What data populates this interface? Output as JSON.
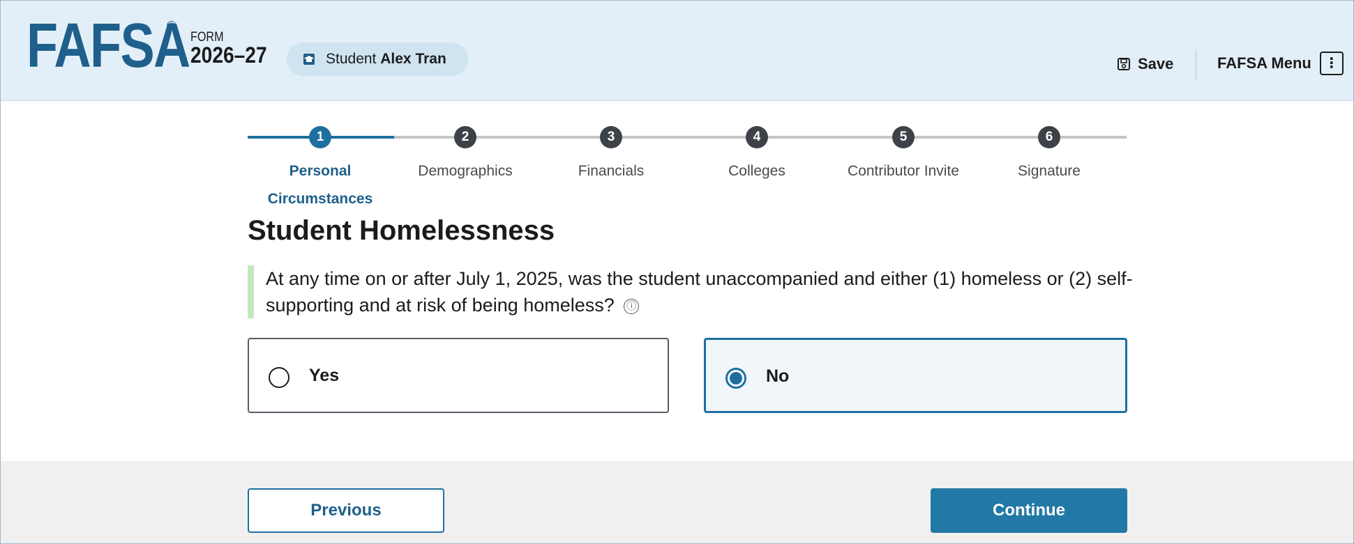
{
  "header": {
    "logo": "FAFSA",
    "logo_mark": "®",
    "form_label": "FORM",
    "form_year": "2026–27",
    "student_prefix": "Student",
    "student_name": "Alex Tran",
    "student_icon": "graduation-cap-icon",
    "save_label": "Save",
    "save_icon": "floppy-disk-icon",
    "menu_label": "FAFSA Menu",
    "menu_icon": "kebab-icon"
  },
  "stepper": {
    "steps": [
      {
        "number": "1",
        "label": "Personal Circumstances",
        "active": true
      },
      {
        "number": "2",
        "label": "Demographics",
        "active": false
      },
      {
        "number": "3",
        "label": "Financials",
        "active": false
      },
      {
        "number": "4",
        "label": "Colleges",
        "active": false
      },
      {
        "number": "5",
        "label": "Contributor Invite",
        "active": false
      },
      {
        "number": "6",
        "label": "Signature",
        "active": false
      }
    ]
  },
  "main": {
    "title": "Student Homelessness",
    "question": "At any time on or after July 1, 2025, was the student unaccompanied and either (1) homeless or (2) self-supporting and at risk of being homeless?",
    "info_icon": "ⓘ",
    "options": [
      {
        "label": "Yes",
        "selected": false
      },
      {
        "label": "No",
        "selected": true
      }
    ]
  },
  "footer": {
    "previous_label": "Previous",
    "continue_label": "Continue"
  },
  "colors": {
    "primary": "#1f6ea0",
    "header_bg": "#e3eff8",
    "accent_bar": "#c4e6bf"
  }
}
